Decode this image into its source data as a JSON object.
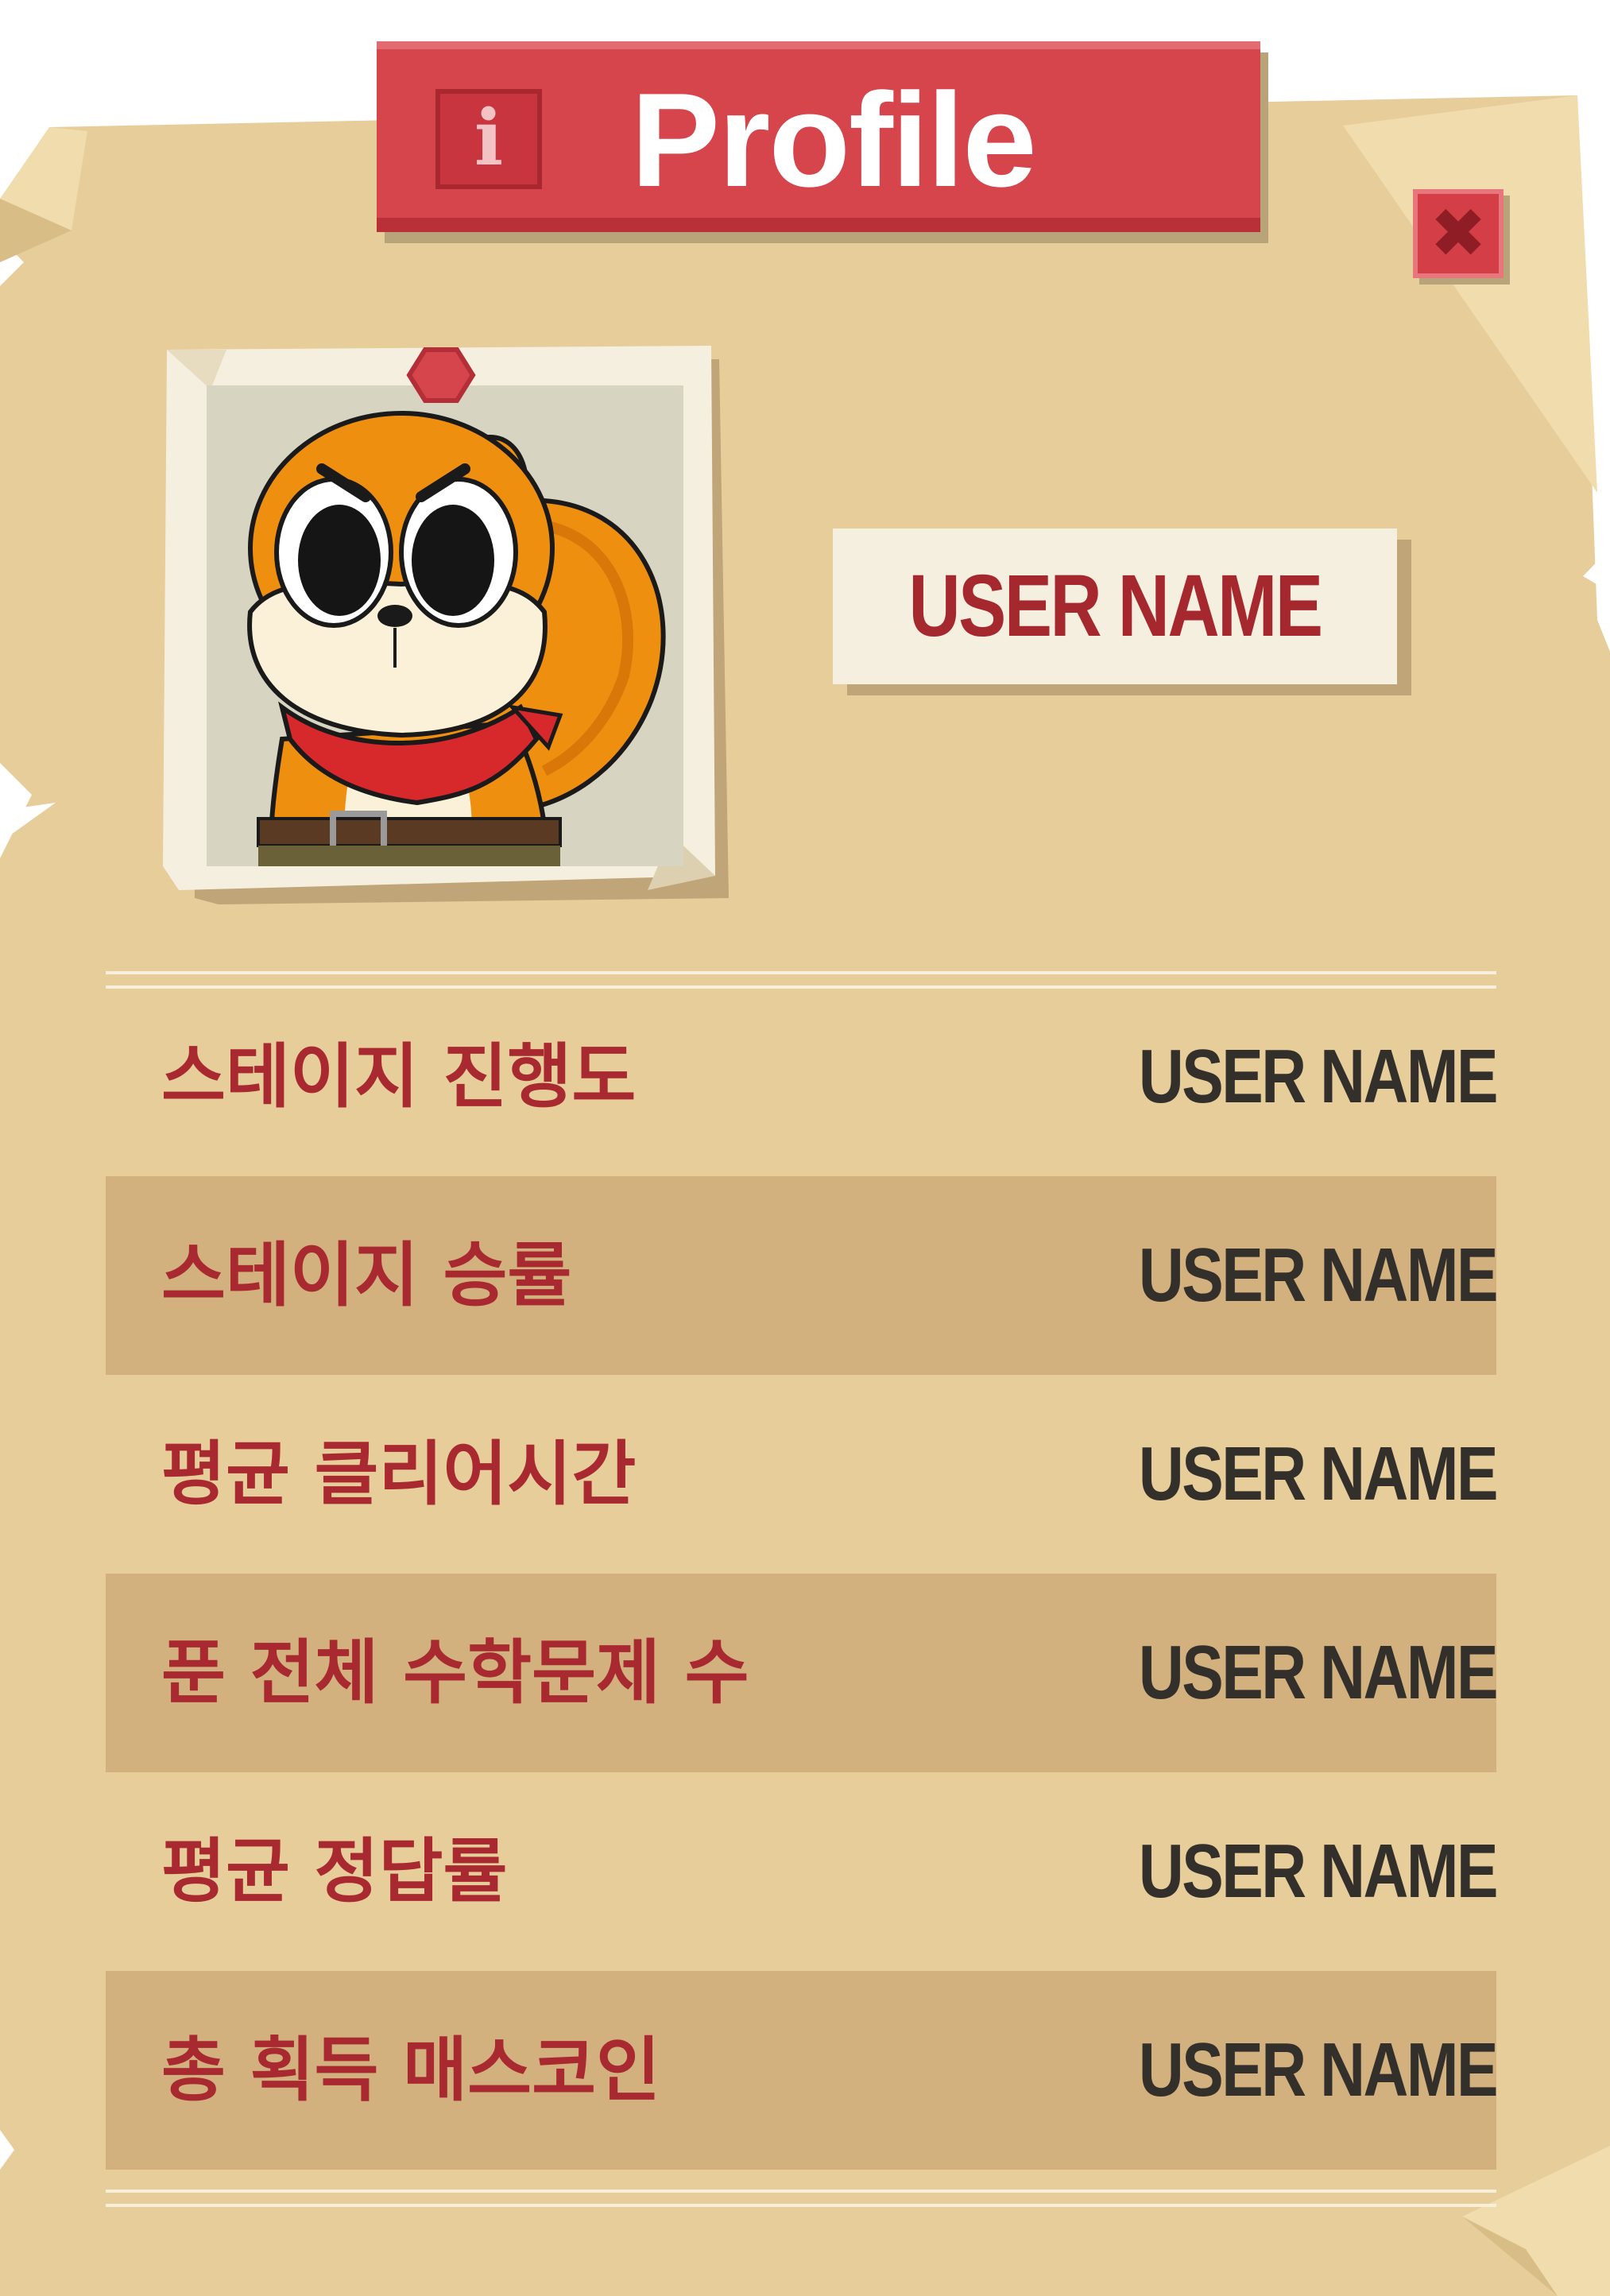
{
  "header": {
    "title": "Profile",
    "info_icon_glyph": "i",
    "close_glyph": "✖"
  },
  "profile": {
    "avatar_icon": "squirrel-avatar",
    "user_name": "USER NAME"
  },
  "stats": [
    {
      "label": "스테이지 진행도",
      "value": "USER NAME",
      "shaded": false
    },
    {
      "label": "스테이지 승률",
      "value": "USER NAME",
      "shaded": true
    },
    {
      "label": "평균 클리어시간",
      "value": "USER NAME",
      "shaded": false
    },
    {
      "label": "푼 전체 수학문제 수",
      "value": "USER NAME",
      "shaded": true
    },
    {
      "label": "평균 정답률",
      "value": "USER NAME",
      "shaded": false
    },
    {
      "label": "총 획득 매스코인",
      "value": "USER NAME",
      "shaded": true
    }
  ],
  "colors": {
    "paper": "#e6cd9a",
    "paper_light": "#f1dcae",
    "banner_red": "#d6444c",
    "label_red": "#a82a30",
    "value_dark": "#33302c",
    "row_shade": "#d2b17e"
  }
}
